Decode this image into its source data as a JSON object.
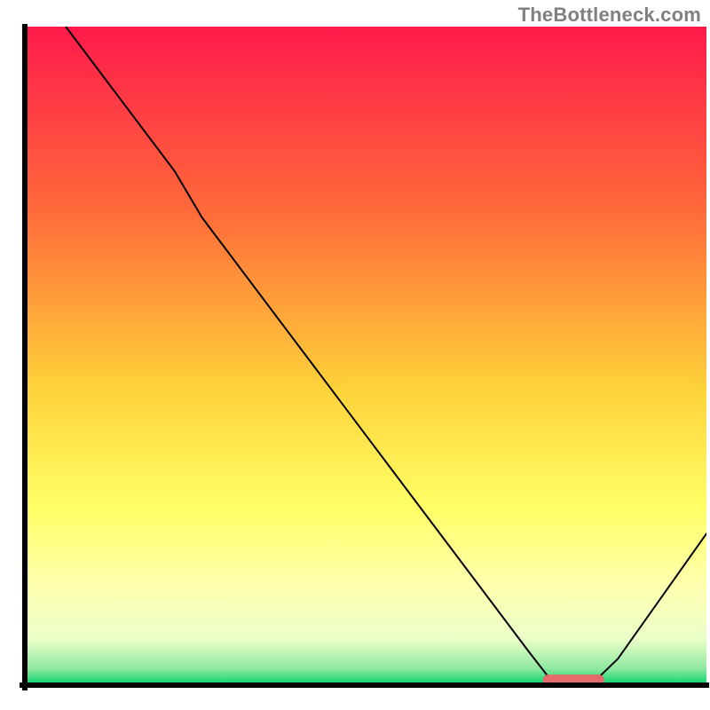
{
  "watermark": "TheBottleneck.com",
  "chart_data": {
    "type": "line",
    "title": "",
    "xlabel": "",
    "ylabel": "",
    "xlim": [
      0,
      100
    ],
    "ylim": [
      0,
      100
    ],
    "background_gradient": {
      "stops": [
        {
          "offset": 0,
          "color": "#ff1a4b"
        },
        {
          "offset": 0.28,
          "color": "#ff6a3a"
        },
        {
          "offset": 0.55,
          "color": "#ffd23a"
        },
        {
          "offset": 0.73,
          "color": "#ffff66"
        },
        {
          "offset": 0.85,
          "color": "#ffffb0"
        },
        {
          "offset": 0.93,
          "color": "#eaffc8"
        },
        {
          "offset": 0.975,
          "color": "#8fe8a0"
        },
        {
          "offset": 1.0,
          "color": "#00d46a"
        }
      ]
    },
    "series": [
      {
        "name": "bottleneck-curve",
        "color": "#000000",
        "width": 2,
        "points": [
          {
            "x": 6,
            "y": 100
          },
          {
            "x": 22,
            "y": 78
          },
          {
            "x": 26,
            "y": 71
          },
          {
            "x": 74,
            "y": 5
          },
          {
            "x": 77,
            "y": 1
          },
          {
            "x": 84,
            "y": 1
          },
          {
            "x": 87,
            "y": 4
          },
          {
            "x": 100,
            "y": 23
          }
        ]
      }
    ],
    "marker": {
      "name": "optimal-range",
      "color": "#e56a6a",
      "y": 0.8,
      "x_start": 76,
      "x_end": 85,
      "thickness": 12,
      "radius": 6
    },
    "axes": {
      "color": "#000000",
      "width": 6
    }
  }
}
